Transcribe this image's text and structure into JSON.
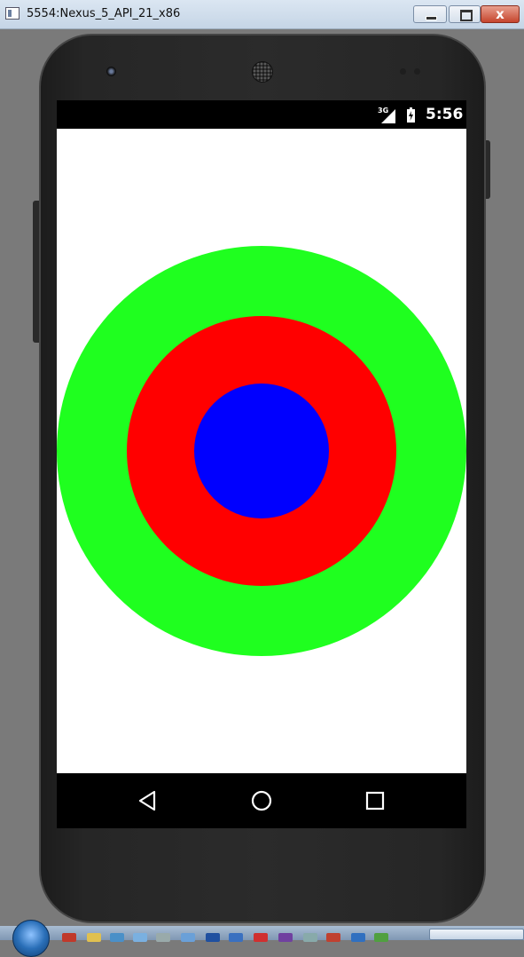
{
  "window": {
    "title": "5554:Nexus_5_API_21_x86",
    "controls": {
      "minimize_icon": "minimize-icon",
      "maximize_icon": "maximize-icon",
      "close_label": "x"
    }
  },
  "status_bar": {
    "network_type": "3G",
    "signal_icon": "cell-signal-icon",
    "battery_icon": "battery-charging-icon",
    "time": "5:56"
  },
  "content": {
    "circles": [
      {
        "name": "outer",
        "color": "#1fff1f"
      },
      {
        "name": "middle",
        "color": "#ff0000"
      },
      {
        "name": "inner",
        "color": "#0000ff"
      }
    ]
  },
  "nav_bar": {
    "back_icon": "back-triangle-icon",
    "home_icon": "home-circle-icon",
    "recents_icon": "recents-square-icon"
  },
  "taskbar": {
    "start_icon": "windows-start-icon"
  }
}
